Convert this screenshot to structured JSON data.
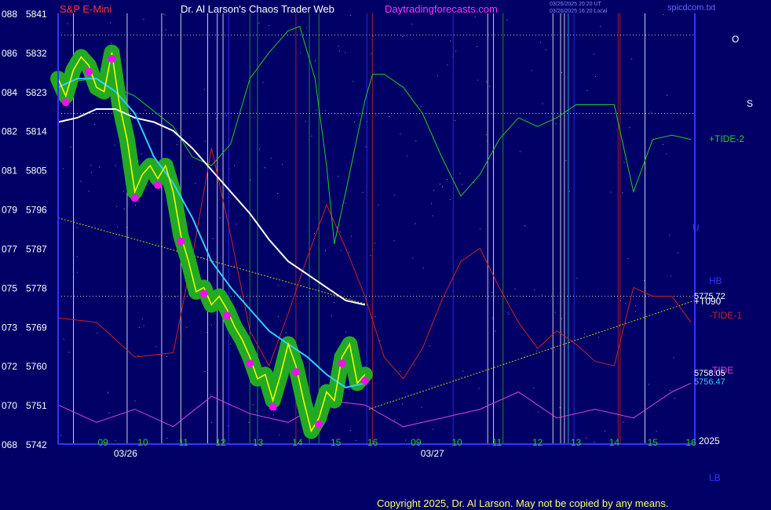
{
  "header": {
    "symbol": "S&P E-Mini",
    "title": "Dr. Al Larson's Chaos Trader Web",
    "site": "Daytradingforecasts.com",
    "ts1": "03/26/2025 20:20 UT",
    "ts2": "03/26/2025 16:20 Local",
    "file": "spicdcom.txt"
  },
  "footer": {
    "copyright": "Copyright 2025, Dr. Al Larson. May not be copied by any means."
  },
  "colors": {
    "background": "#000066",
    "price": "#ffff00",
    "price_glow": "#22aa22",
    "ma_fast": "#33ccff",
    "ma_slow": "#ffffff",
    "tide_plus": "#22cc22",
    "tide_minus": "#cc2222",
    "cycle": "#dd44dd",
    "ma_blue": "#2233cc"
  },
  "chart_data": {
    "type": "line",
    "title": "S&P E-Mini",
    "ylim": [
      5742,
      5841
    ],
    "y_ticks_price": [
      5841,
      5832,
      5823,
      5814,
      5805,
      5796,
      5787,
      5778,
      5769,
      5760,
      5751,
      5742
    ],
    "y_ticks_alt": [
      "088",
      "086",
      "084",
      "082",
      "081",
      "079",
      "077",
      "075",
      "073",
      "072",
      "070",
      "068"
    ],
    "x_hour_labels": [
      "09",
      "10",
      "11",
      "12",
      "13",
      "14",
      "15",
      "16",
      "09",
      "10",
      "11",
      "12",
      "13",
      "14",
      "15",
      "16"
    ],
    "x_hours": [
      9.17,
      10.21,
      11.27,
      12.24,
      13.21,
      14.24,
      15.24,
      16.2,
      17.33,
      18.4,
      19.44,
      20.5,
      21.5,
      22.5,
      23.5,
      24.5
    ],
    "date_labels": [
      {
        "text": "03/26",
        "x": 9.0
      },
      {
        "text": "03/27",
        "x": 17.0
      }
    ],
    "year_label": "2025",
    "x_range": [
      8.0,
      24.6
    ],
    "last_price": "5775.72",
    "ma_fast_last": "5756.47",
    "ma_slow_last": "5758.05",
    "right_labels": [
      "O",
      "S",
      "+TIDE-2",
      "HB",
      "+T090",
      "-TIDE-1",
      "-TIDE",
      "LB",
      "U"
    ],
    "series": [
      {
        "name": "price",
        "x": [
          8.0,
          8.2,
          8.4,
          8.6,
          8.8,
          9.0,
          9.2,
          9.4,
          9.6,
          9.8,
          10.0,
          10.2,
          10.4,
          10.6,
          10.8,
          11.0,
          11.2,
          11.4,
          11.6,
          11.8,
          12.0,
          12.2,
          12.4,
          12.6,
          12.8,
          13.0,
          13.2,
          13.4,
          13.6,
          13.8,
          14.0,
          14.2,
          14.4,
          14.6,
          14.8,
          15.0,
          15.2,
          15.4,
          15.6,
          15.8,
          16.0
        ],
        "y": [
          5826,
          5822,
          5828,
          5831,
          5829,
          5824,
          5823,
          5832,
          5820,
          5812,
          5800,
          5804,
          5806,
          5803,
          5806,
          5800,
          5790,
          5784,
          5777,
          5778,
          5774,
          5776,
          5773,
          5769,
          5766,
          5762,
          5757,
          5758,
          5752,
          5758,
          5765,
          5760,
          5752,
          5745,
          5748,
          5754,
          5752,
          5762,
          5765,
          5756,
          5758
        ]
      },
      {
        "name": "fast MA",
        "x": [
          8.0,
          8.5,
          9.0,
          9.5,
          10.0,
          10.5,
          11.0,
          11.5,
          12.0,
          12.5,
          13.0,
          13.5,
          14.0,
          14.5,
          15.0,
          15.5,
          16.0
        ],
        "y": [
          5824,
          5826,
          5826,
          5823,
          5818,
          5808,
          5802,
          5794,
          5784,
          5778,
          5773,
          5768,
          5765,
          5762,
          5758,
          5755,
          5756
        ]
      },
      {
        "name": "slow MA",
        "x": [
          8.0,
          8.5,
          9.0,
          9.5,
          10.0,
          10.5,
          11.0,
          11.5,
          12.0,
          12.5,
          13.0,
          13.5,
          14.0,
          14.5,
          15.0,
          15.5,
          16.0
        ],
        "y": [
          5816,
          5817,
          5819,
          5819,
          5817,
          5816,
          5814,
          5810,
          5805,
          5800,
          5795,
          5789,
          5784,
          5781,
          5778,
          5775,
          5774
        ]
      },
      {
        "name": "+TIDE-2",
        "x": [
          8.0,
          9.0,
          10.0,
          11.0,
          11.5,
          12.0,
          12.5,
          13.0,
          13.5,
          14.0,
          14.3,
          14.7,
          15.0,
          15.2,
          15.5,
          16.0,
          16.2,
          16.5,
          17.0,
          17.5,
          18.0,
          18.5,
          19.0,
          19.5,
          20.0,
          20.5,
          21.0,
          21.5,
          22.0,
          22.5,
          23.0,
          23.5,
          24.0,
          24.5
        ],
        "y": [
          5825,
          5826,
          5822,
          5815,
          5808,
          5806,
          5811,
          5826,
          5832,
          5837,
          5838,
          5826,
          5806,
          5788,
          5800,
          5821,
          5827,
          5827,
          5824,
          5818,
          5808,
          5799,
          5804,
          5812,
          5817,
          5815,
          5817,
          5820,
          5820,
          5820,
          5800,
          5812,
          5813,
          5812
        ]
      },
      {
        "name": "-TIDE-1",
        "x": [
          8.0,
          9.0,
          10.0,
          11.0,
          11.5,
          12.0,
          12.5,
          13.0,
          13.5,
          14.0,
          14.5,
          15.0,
          15.5,
          16.0,
          16.5,
          17.0,
          17.5,
          18.0,
          18.5,
          19.0,
          19.5,
          20.0,
          20.5,
          21.0,
          21.5,
          22.0,
          22.5,
          23.0,
          23.5,
          24.0,
          24.5
        ],
        "y": [
          5771,
          5770,
          5762,
          5763,
          5785,
          5810,
          5790,
          5768,
          5760,
          5772,
          5785,
          5797,
          5787,
          5776,
          5762,
          5757,
          5764,
          5775,
          5784,
          5787,
          5778,
          5770,
          5764,
          5768,
          5765,
          5761,
          5760,
          5778,
          5776,
          5776,
          5770
        ]
      },
      {
        "name": "cycle",
        "x": [
          8.0,
          9.0,
          10.0,
          11.0,
          12.0,
          13.0,
          14.0,
          15.0,
          16.0,
          17.0,
          18.0,
          19.0,
          20.0,
          21.0,
          22.0,
          23.0,
          24.0,
          24.5
        ],
        "y": [
          5751,
          5747,
          5750,
          5746,
          5753,
          5749,
          5747,
          5752,
          5751,
          5746,
          5748,
          5750,
          5754,
          5748,
          5750,
          5748,
          5754,
          5756
        ]
      }
    ]
  }
}
